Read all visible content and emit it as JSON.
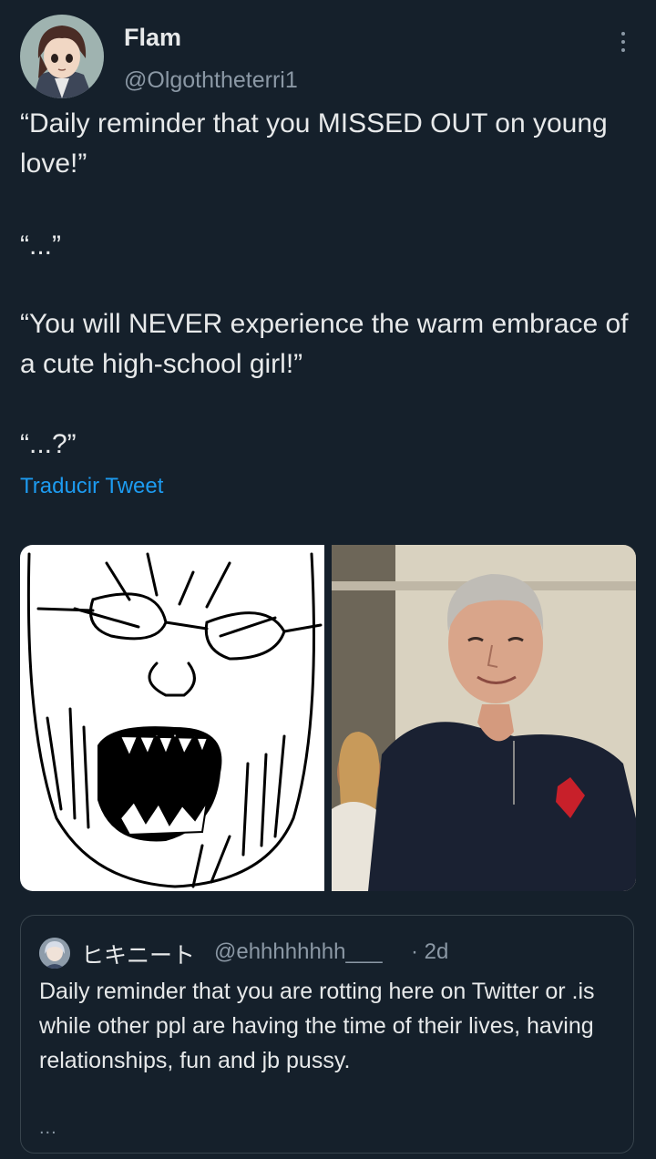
{
  "tweet": {
    "author_name": "Flam",
    "author_handle": "@Olgoththeterri1",
    "paragraphs": [
      "“Daily reminder that you MISSED OUT on young love!”",
      "“...”",
      "“You will NEVER experience the warm embrace of a cute high-school girl!”",
      "“...?”"
    ],
    "translate_label": "Traducir Tweet"
  },
  "quoted_tweet": {
    "author_name": "ヒキニート",
    "author_handle": "@ehhhhhhhh___",
    "time": "· 2d",
    "text": "Daily reminder that you are rotting here on Twitter or .is while other ppl are having the time of their lives, having relationships, fun and jb pussy.",
    "more_label": "..."
  },
  "icons": {
    "more_options": "more-vertical-icon",
    "avatar": "anime-avatar"
  },
  "colors": {
    "background": "#15202b",
    "text": "#e7e9ea",
    "secondary": "#8b98a5",
    "link": "#1d9bf0",
    "border": "#38444d"
  }
}
